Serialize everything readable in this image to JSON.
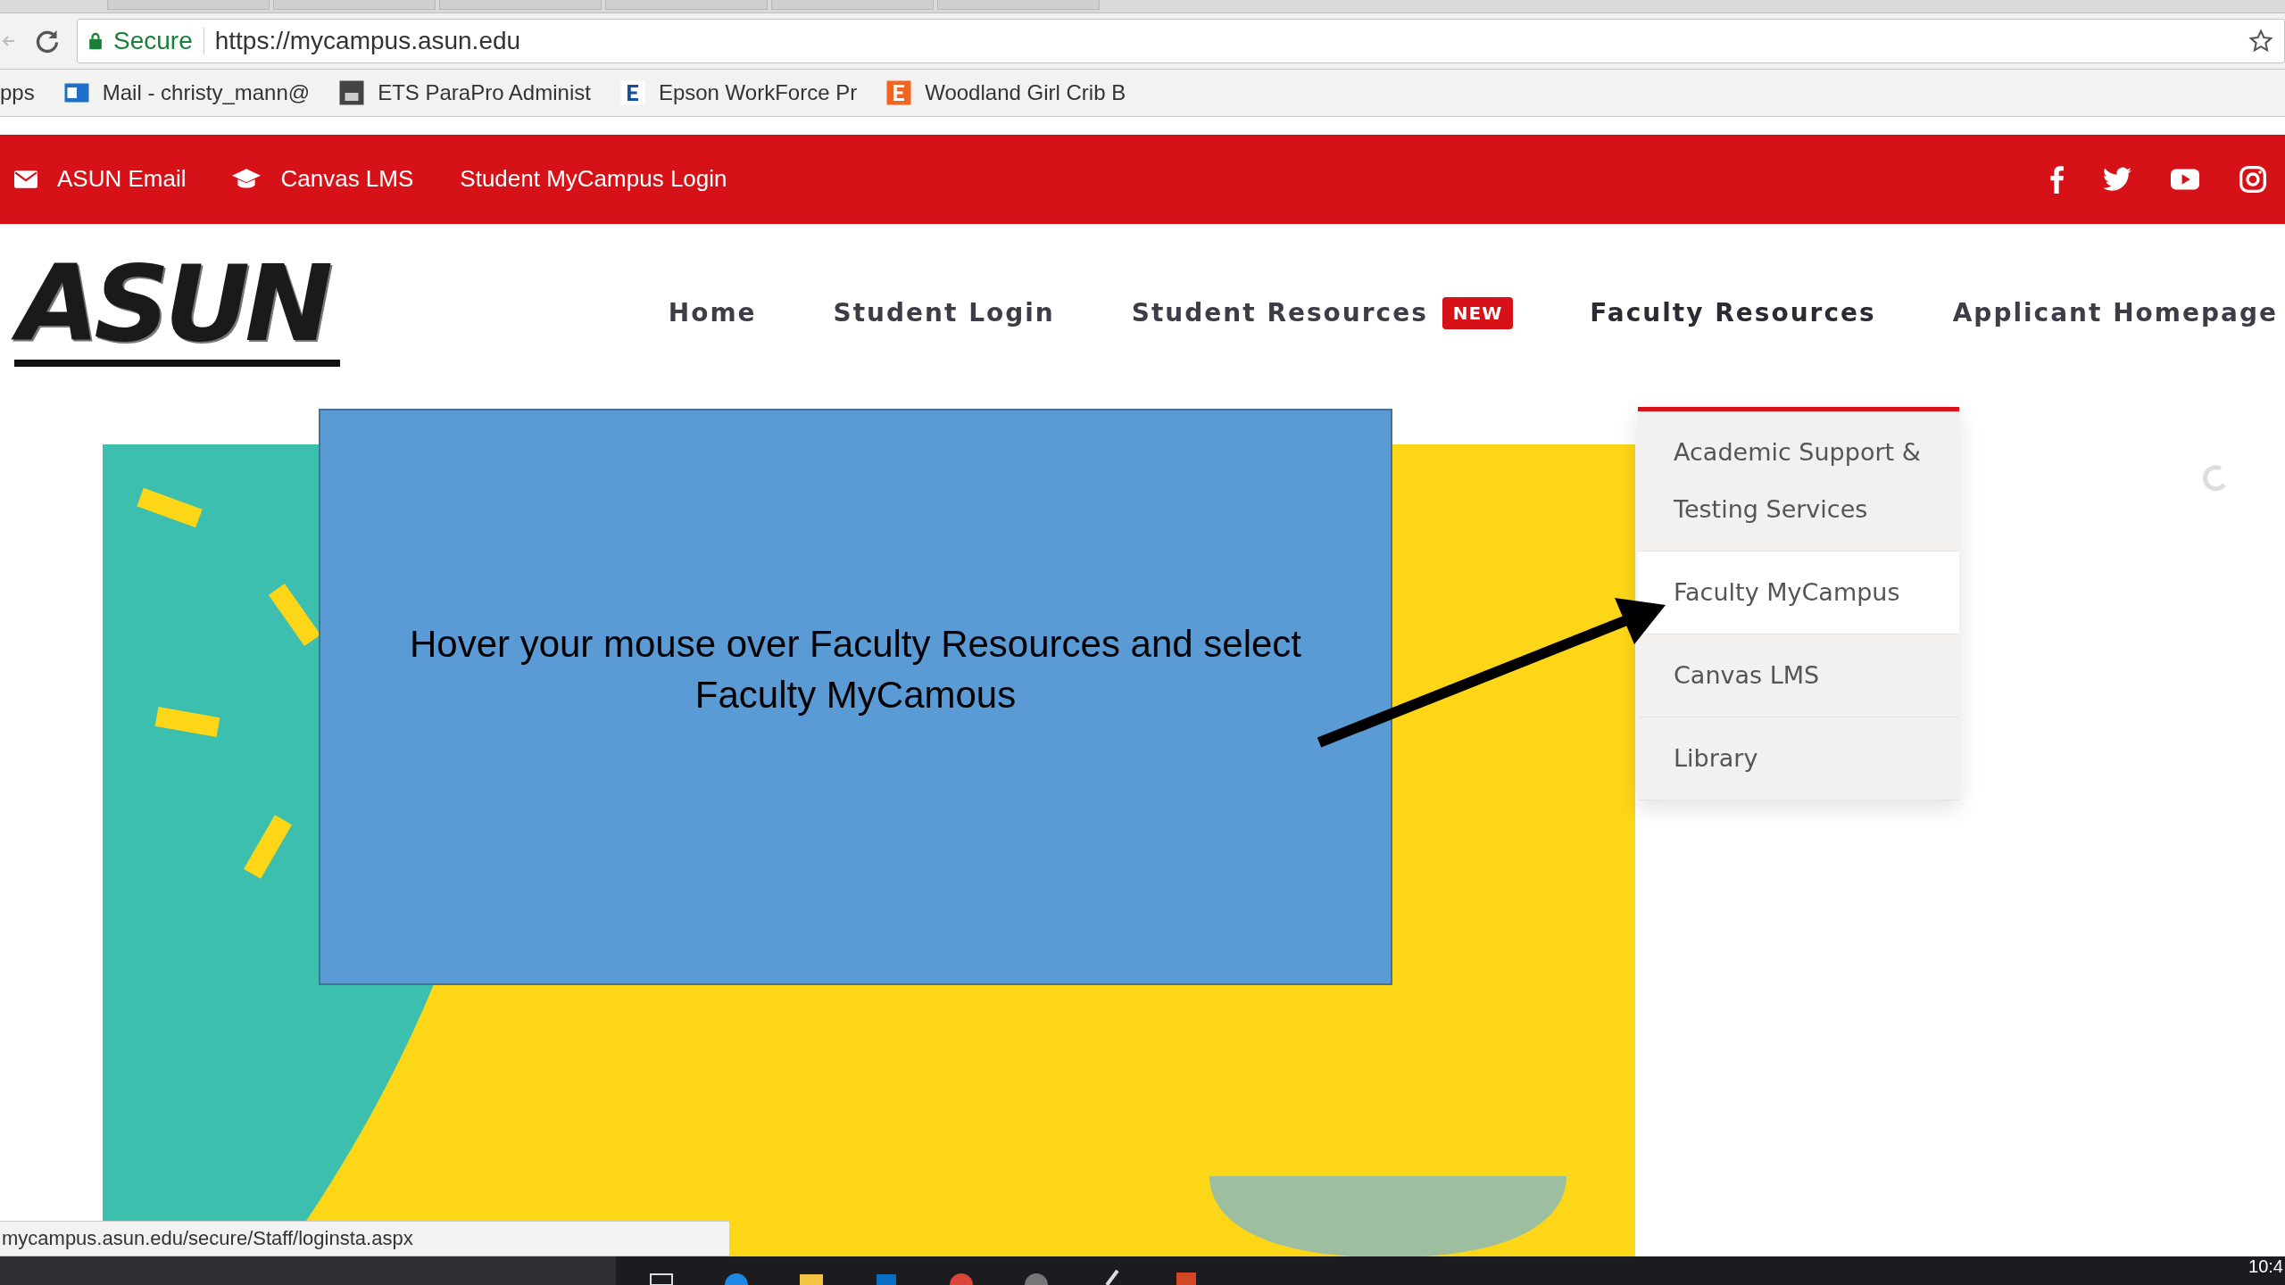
{
  "browser": {
    "secure_label": "Secure",
    "url": "https://mycampus.asun.edu",
    "bookmarks": [
      {
        "label": "pps",
        "kind": "apps"
      },
      {
        "label": "Mail - christy_mann@",
        "kind": "mail"
      },
      {
        "label": "ETS ParaPro Administ",
        "kind": "eap"
      },
      {
        "label": "Epson WorkForce Pr",
        "kind": "letter"
      },
      {
        "label": "Woodland Girl Crib B",
        "kind": "shop"
      }
    ]
  },
  "top_bar": {
    "links": [
      {
        "label": "ASUN Email",
        "kind": "email"
      },
      {
        "label": "Canvas LMS",
        "kind": "cap"
      },
      {
        "label": "Student MyCampus Login",
        "kind": "plain"
      }
    ],
    "social": [
      {
        "kind": "facebook"
      },
      {
        "kind": "twitter"
      },
      {
        "kind": "youtube"
      },
      {
        "kind": "instagram"
      }
    ]
  },
  "header": {
    "logo": "ASUN",
    "nav": [
      {
        "label": "Home",
        "expanded": false
      },
      {
        "label": "Student Login",
        "expanded": false
      },
      {
        "label": "Student Resources",
        "badge": "NEW",
        "expanded": false
      },
      {
        "label": "Faculty Resources",
        "expanded": true
      },
      {
        "label": "Applicant Homepage",
        "expanded": false
      }
    ]
  },
  "dropdown": [
    {
      "label": "Academic Support & Testing Services",
      "selected": false
    },
    {
      "label": "Faculty MyCampus",
      "selected": true
    },
    {
      "label": "Canvas LMS",
      "selected": false
    },
    {
      "label": "Library",
      "selected": false
    }
  ],
  "callout": {
    "text": "Hover your mouse over Faculty Resources and select Faculty MyCamous"
  },
  "status_url": "mycampus.asun.edu/secure/Staff/loginsta.aspx",
  "taskbar": {
    "clock": "10:4"
  }
}
